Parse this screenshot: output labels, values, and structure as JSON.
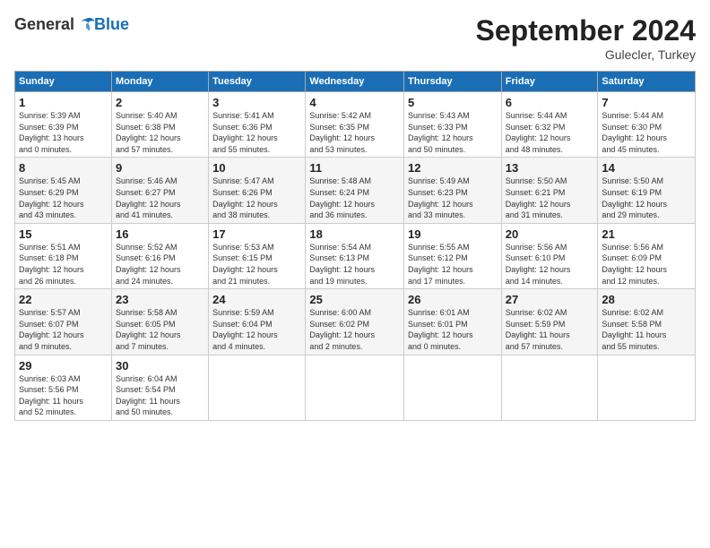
{
  "logo": {
    "general": "General",
    "blue": "Blue"
  },
  "header": {
    "month": "September 2024",
    "location": "Gulecler, Turkey"
  },
  "weekdays": [
    "Sunday",
    "Monday",
    "Tuesday",
    "Wednesday",
    "Thursday",
    "Friday",
    "Saturday"
  ],
  "weeks": [
    [
      {
        "day": "1",
        "info": "Sunrise: 5:39 AM\nSunset: 6:39 PM\nDaylight: 13 hours\nand 0 minutes."
      },
      {
        "day": "2",
        "info": "Sunrise: 5:40 AM\nSunset: 6:38 PM\nDaylight: 12 hours\nand 57 minutes."
      },
      {
        "day": "3",
        "info": "Sunrise: 5:41 AM\nSunset: 6:36 PM\nDaylight: 12 hours\nand 55 minutes."
      },
      {
        "day": "4",
        "info": "Sunrise: 5:42 AM\nSunset: 6:35 PM\nDaylight: 12 hours\nand 53 minutes."
      },
      {
        "day": "5",
        "info": "Sunrise: 5:43 AM\nSunset: 6:33 PM\nDaylight: 12 hours\nand 50 minutes."
      },
      {
        "day": "6",
        "info": "Sunrise: 5:44 AM\nSunset: 6:32 PM\nDaylight: 12 hours\nand 48 minutes."
      },
      {
        "day": "7",
        "info": "Sunrise: 5:44 AM\nSunset: 6:30 PM\nDaylight: 12 hours\nand 45 minutes."
      }
    ],
    [
      {
        "day": "8",
        "info": "Sunrise: 5:45 AM\nSunset: 6:29 PM\nDaylight: 12 hours\nand 43 minutes."
      },
      {
        "day": "9",
        "info": "Sunrise: 5:46 AM\nSunset: 6:27 PM\nDaylight: 12 hours\nand 41 minutes."
      },
      {
        "day": "10",
        "info": "Sunrise: 5:47 AM\nSunset: 6:26 PM\nDaylight: 12 hours\nand 38 minutes."
      },
      {
        "day": "11",
        "info": "Sunrise: 5:48 AM\nSunset: 6:24 PM\nDaylight: 12 hours\nand 36 minutes."
      },
      {
        "day": "12",
        "info": "Sunrise: 5:49 AM\nSunset: 6:23 PM\nDaylight: 12 hours\nand 33 minutes."
      },
      {
        "day": "13",
        "info": "Sunrise: 5:50 AM\nSunset: 6:21 PM\nDaylight: 12 hours\nand 31 minutes."
      },
      {
        "day": "14",
        "info": "Sunrise: 5:50 AM\nSunset: 6:19 PM\nDaylight: 12 hours\nand 29 minutes."
      }
    ],
    [
      {
        "day": "15",
        "info": "Sunrise: 5:51 AM\nSunset: 6:18 PM\nDaylight: 12 hours\nand 26 minutes."
      },
      {
        "day": "16",
        "info": "Sunrise: 5:52 AM\nSunset: 6:16 PM\nDaylight: 12 hours\nand 24 minutes."
      },
      {
        "day": "17",
        "info": "Sunrise: 5:53 AM\nSunset: 6:15 PM\nDaylight: 12 hours\nand 21 minutes."
      },
      {
        "day": "18",
        "info": "Sunrise: 5:54 AM\nSunset: 6:13 PM\nDaylight: 12 hours\nand 19 minutes."
      },
      {
        "day": "19",
        "info": "Sunrise: 5:55 AM\nSunset: 6:12 PM\nDaylight: 12 hours\nand 17 minutes."
      },
      {
        "day": "20",
        "info": "Sunrise: 5:56 AM\nSunset: 6:10 PM\nDaylight: 12 hours\nand 14 minutes."
      },
      {
        "day": "21",
        "info": "Sunrise: 5:56 AM\nSunset: 6:09 PM\nDaylight: 12 hours\nand 12 minutes."
      }
    ],
    [
      {
        "day": "22",
        "info": "Sunrise: 5:57 AM\nSunset: 6:07 PM\nDaylight: 12 hours\nand 9 minutes."
      },
      {
        "day": "23",
        "info": "Sunrise: 5:58 AM\nSunset: 6:05 PM\nDaylight: 12 hours\nand 7 minutes."
      },
      {
        "day": "24",
        "info": "Sunrise: 5:59 AM\nSunset: 6:04 PM\nDaylight: 12 hours\nand 4 minutes."
      },
      {
        "day": "25",
        "info": "Sunrise: 6:00 AM\nSunset: 6:02 PM\nDaylight: 12 hours\nand 2 minutes."
      },
      {
        "day": "26",
        "info": "Sunrise: 6:01 AM\nSunset: 6:01 PM\nDaylight: 12 hours\nand 0 minutes."
      },
      {
        "day": "27",
        "info": "Sunrise: 6:02 AM\nSunset: 5:59 PM\nDaylight: 11 hours\nand 57 minutes."
      },
      {
        "day": "28",
        "info": "Sunrise: 6:02 AM\nSunset: 5:58 PM\nDaylight: 11 hours\nand 55 minutes."
      }
    ],
    [
      {
        "day": "29",
        "info": "Sunrise: 6:03 AM\nSunset: 5:56 PM\nDaylight: 11 hours\nand 52 minutes."
      },
      {
        "day": "30",
        "info": "Sunrise: 6:04 AM\nSunset: 5:54 PM\nDaylight: 11 hours\nand 50 minutes."
      },
      {
        "day": "",
        "info": ""
      },
      {
        "day": "",
        "info": ""
      },
      {
        "day": "",
        "info": ""
      },
      {
        "day": "",
        "info": ""
      },
      {
        "day": "",
        "info": ""
      }
    ]
  ]
}
